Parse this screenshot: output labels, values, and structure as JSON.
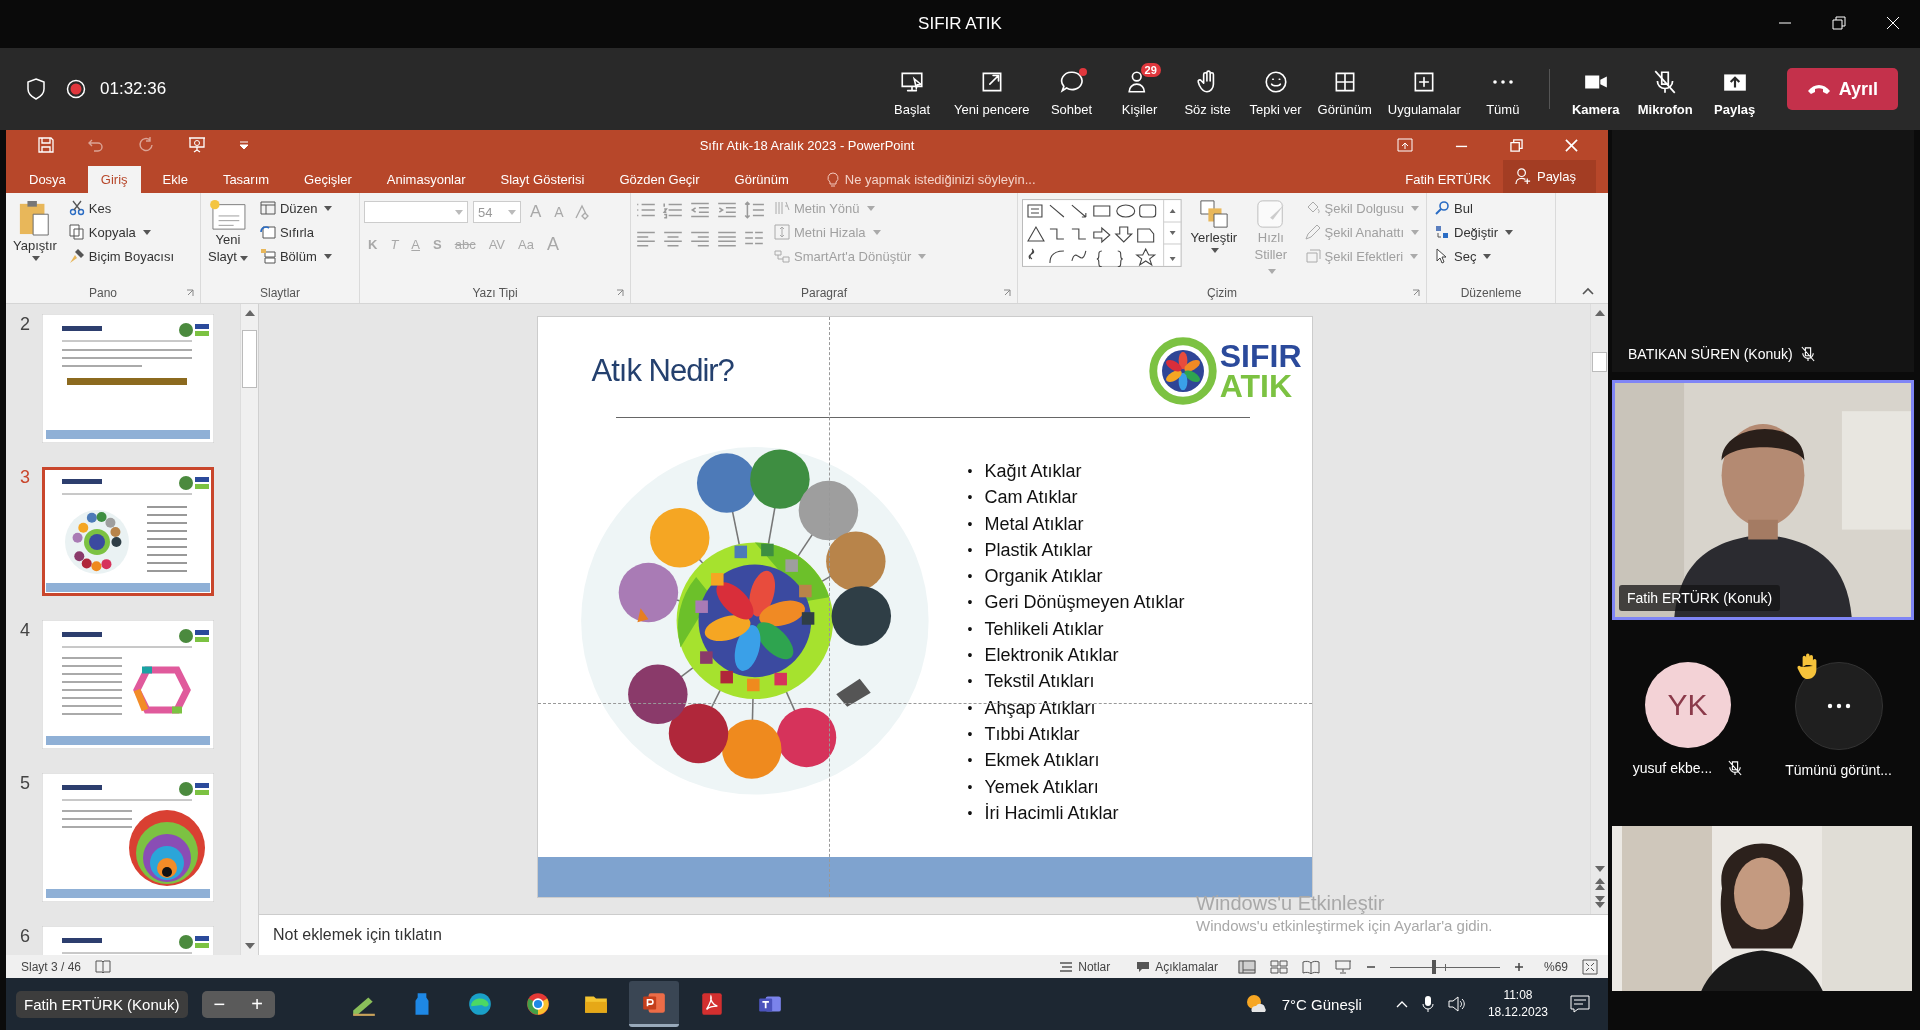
{
  "teams_window": {
    "title": "SIFIR ATIK"
  },
  "meeting_bar": {
    "recording": true,
    "elapsed": "01:32:36",
    "buttons": [
      {
        "label": "Başlat"
      },
      {
        "label": "Yeni pencere"
      },
      {
        "label": "Sohbet",
        "unread": true
      },
      {
        "label": "Kişiler",
        "badge": "29"
      },
      {
        "label": "Söz iste"
      },
      {
        "label": "Tepki ver"
      },
      {
        "label": "Görünüm"
      },
      {
        "label": "Uygulamalar"
      },
      {
        "label": "Tümü"
      }
    ],
    "device_buttons": [
      {
        "label": "Kamera",
        "off": false
      },
      {
        "label": "Mikrofon",
        "off": true
      },
      {
        "label": "Paylaş",
        "off": false
      }
    ],
    "leave_button": "Ayrıl"
  },
  "powerpoint": {
    "title": "Sıfır Atık-18 Aralık 2023 - PowerPoint",
    "tabs": [
      {
        "label": "Dosya",
        "selected": false
      },
      {
        "label": "Giriş",
        "selected": true
      },
      {
        "label": "Ekle",
        "selected": false
      },
      {
        "label": "Tasarım",
        "selected": false
      },
      {
        "label": "Geçişler",
        "selected": false
      },
      {
        "label": "Animasyonlar",
        "selected": false
      },
      {
        "label": "Slayt Gösterisi",
        "selected": false
      },
      {
        "label": "Gözden Geçir",
        "selected": false
      },
      {
        "label": "Görünüm",
        "selected": false
      }
    ],
    "tell_me": "Ne yapmak istediğinizi söyleyin...",
    "user": "Fatih ERTÜRK",
    "share": "Paylaş",
    "ribbon": {
      "pano": {
        "label": "Pano",
        "paste": "Yapıştır",
        "items": [
          "Kes",
          "Kopyala",
          "Biçim Boyacısı"
        ]
      },
      "slaytlar": {
        "label": "Slaytlar",
        "new_slide": [
          "Yeni",
          "Slayt"
        ],
        "items": [
          "Düzen",
          "Sıfırla",
          "Bölüm"
        ]
      },
      "yazi_tipi": {
        "label": "Yazı Tipi",
        "font_size": "54",
        "disabled": true,
        "size_buttons": [
          "A",
          "A"
        ],
        "style_buttons": [
          "K",
          "T",
          "A",
          "S",
          "abc",
          "AV",
          "Aa",
          "A"
        ]
      },
      "paragraf": {
        "label": "Paragraf",
        "items": [
          {
            "label": "Metin Yönü",
            "disabled": true
          },
          {
            "label": "Metni Hizala",
            "disabled": true
          },
          {
            "label": "SmartArt'a Dönüştür",
            "disabled": true
          }
        ]
      },
      "cizim": {
        "label": "Çizim",
        "arrange": "Yerleştir",
        "quick_styles": {
          "lines": [
            "Hızlı",
            "Stiller"
          ],
          "disabled": true
        },
        "items": [
          {
            "label": "Şekil Dolgusu",
            "disabled": true
          },
          {
            "label": "Şekil Anahattı",
            "disabled": true
          },
          {
            "label": "Şekil Efektleri",
            "disabled": true
          }
        ]
      },
      "duzenleme": {
        "label": "Düzenleme",
        "items": [
          "Bul",
          "Değiştir",
          "Seç"
        ]
      }
    }
  },
  "slides": [
    {
      "number": "2",
      "selected": false
    },
    {
      "number": "3",
      "selected": true
    },
    {
      "number": "4",
      "selected": false
    },
    {
      "number": "5",
      "selected": false
    },
    {
      "number": "6",
      "selected": false
    }
  ],
  "slide": {
    "title": "Atık Nedir?",
    "logo": [
      "SIFIR",
      "ATIK"
    ],
    "bullets": [
      {
        "marker": "•",
        "text": "Kağıt Atıklar"
      },
      {
        "marker": "•",
        "text": "Cam Atıklar"
      },
      {
        "marker": "•",
        "text": "Metal Atıklar"
      },
      {
        "marker": "•",
        "text": "Plastik Atıklar"
      },
      {
        "marker": "•",
        "text": "Organik Atıklar"
      },
      {
        "marker": "•",
        "text": "Geri Dönüşmeyen Atıklar"
      },
      {
        "marker": "•",
        "text": "Tehlikeli Atıklar"
      },
      {
        "marker": "•",
        "text": "Elektronik Atıklar"
      },
      {
        "marker": "•",
        "text": "Tekstil Atıkları"
      },
      {
        "marker": "•",
        "text": "Ahşap Atıkları"
      },
      {
        "marker": "•",
        "text": "Tıbbi Atıklar"
      },
      {
        "marker": "•",
        "text": "Ekmek Atıkları"
      },
      {
        "marker": "•",
        "text": "Yemek Atıkları"
      },
      {
        "marker": "•",
        "text": "İri Hacimli Atıklar"
      }
    ]
  },
  "notes_placeholder": "Not eklemek için tıklatın",
  "activation_notice": [
    "Windows'u Etkinleştir",
    "Windows'u etkinleştirmek için Ayarlar'a gidin."
  ],
  "status_bar": {
    "slide": "Slayt 3 / 46",
    "notes": "Notlar",
    "comments": "Açıklamalar",
    "zoom": "%69",
    "zoom_slider": {
      "level": 0.4
    }
  },
  "taskbar": {
    "presenter": "Fatih ERTÜRK (Konuk)",
    "zoom_out": "−",
    "zoom_in": "+",
    "apps": [
      {
        "selected": false
      },
      {
        "selected": false
      },
      {
        "selected": false
      },
      {
        "selected": false
      },
      {
        "selected": false
      },
      {
        "selected": true
      },
      {
        "selected": false
      },
      {
        "selected": false
      }
    ],
    "weather": "7°C Güneşli",
    "time": "11:08",
    "date": "18.12.2023"
  },
  "participants": [
    {
      "kind": "blank",
      "name": "BATIKAN SÜREN (Konuk)",
      "muted": true
    },
    {
      "kind": "video",
      "name": "Fatih ERTÜRK (Konuk)",
      "speaking": true
    },
    {
      "kind": "avatar",
      "initials": "YK",
      "name": "yusuf ekbe...",
      "muted": true
    },
    {
      "kind": "more",
      "name": "Tümünü görünt...",
      "hand_raised": true
    },
    {
      "kind": "video"
    }
  ]
}
